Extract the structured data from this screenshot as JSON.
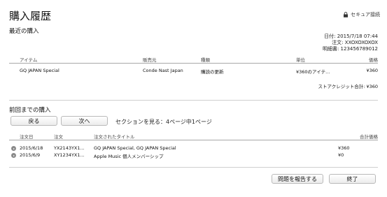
{
  "window": {
    "title": "購入履歴",
    "secure_label": "セキュア接続"
  },
  "recent": {
    "heading": "最近の購入",
    "date_line": "日付: 2015/7/18 07:44",
    "order_line": "注文: XXOXOXOXOX",
    "invoice_line": "明細書: 123456789012",
    "columns": {
      "item": "アイテム",
      "seller": "販売元",
      "type": "種類",
      "unit": "単位",
      "price": "価格"
    },
    "row": {
      "item": "GQ JAPAN Special",
      "seller": "Conde Nast Japan",
      "type": "購読の更新",
      "unit": "¥360のアイテ...",
      "price": "¥360"
    },
    "store_credit_total": "ストアクレジット合計: ¥360"
  },
  "previous": {
    "heading": "前回までの購入",
    "back_label": "戻る",
    "next_label": "次へ",
    "section_text": "セクションを見る：4ページ中1ページ",
    "columns": {
      "date": "注文日",
      "order": "注文",
      "title": "注文されたタイトル",
      "total": "合計価格"
    },
    "rows": [
      {
        "date": "2015/6/18",
        "order": "YX2143YX1...",
        "title": "GQ JAPAN Special, GQ JAPAN Special",
        "total": "¥360"
      },
      {
        "date": "2015/6/9",
        "order": "XY1234YX1...",
        "title": "Apple Music 個人メンバーシップ",
        "total": "¥0"
      }
    ]
  },
  "footer": {
    "report_label": "問題を報告する",
    "done_label": "終了"
  },
  "icons": {
    "secure": "lock-icon",
    "row_open": "arrow-circle-icon"
  },
  "colors": {
    "rule": "#cfcfcf",
    "button_border": "#b9b9b9",
    "arrow_icon": "#8a8a8a"
  }
}
